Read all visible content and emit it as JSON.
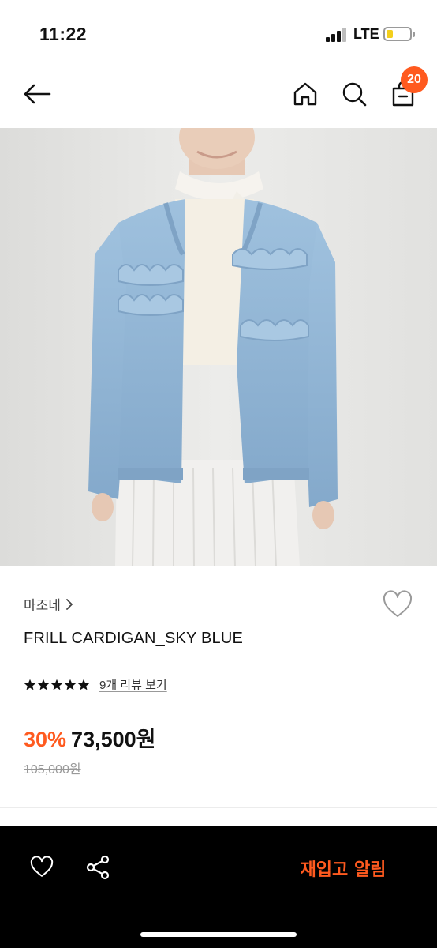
{
  "status": {
    "time": "11:22",
    "network": "LTE"
  },
  "nav": {
    "cart_count": "20"
  },
  "product": {
    "brand": "마조네",
    "title": "FRILL CARDIGAN_SKY BLUE",
    "rating": 5,
    "review_link": "9개 리뷰 보기",
    "discount": "30%",
    "price": "73,500원",
    "original_price": "105,000원"
  },
  "bottom": {
    "restock_label": "재입고 알림"
  },
  "colors": {
    "accent": "#ff5a1f",
    "cardigan": "#8eb3d4",
    "background": "#e9e9e7"
  }
}
